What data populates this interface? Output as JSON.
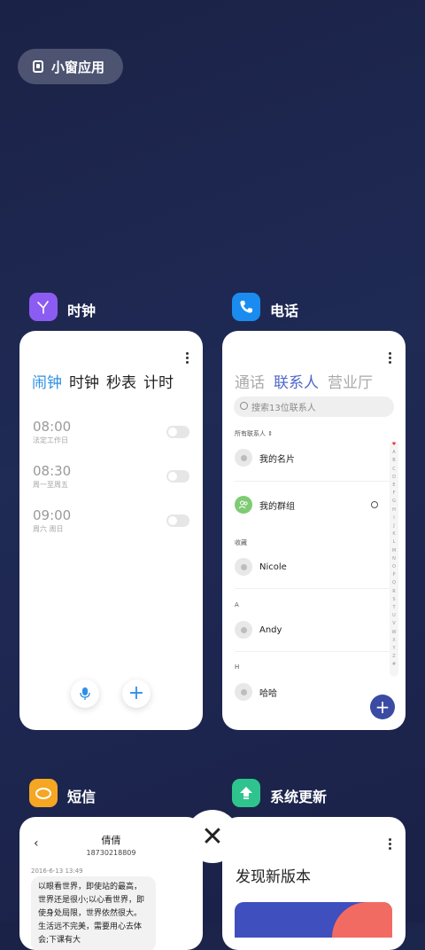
{
  "pill": {
    "label": "小窗应用",
    "icon": "small-window-icon"
  },
  "apps": {
    "clock": {
      "name": "时钟",
      "icon_color": "#8c5cf2",
      "tabs": [
        "闹钟",
        "时钟",
        "秒表",
        "计时"
      ],
      "alarms": [
        {
          "time": "08:00",
          "repeat": "法定工作日",
          "enabled": false
        },
        {
          "time": "08:30",
          "repeat": "周一至周五",
          "enabled": false
        },
        {
          "time": "09:00",
          "repeat": "周六 周日",
          "enabled": false
        }
      ]
    },
    "phone": {
      "name": "电话",
      "icon_color": "#1a8cf0",
      "tabs": [
        "通话",
        "联系人",
        "营业厅"
      ],
      "search_placeholder": "搜索13位联系人",
      "filter": "所有联系人",
      "my_card": "我的名片",
      "my_group": "我的群组",
      "sections": [
        {
          "header": "收藏",
          "contact": "Nicole"
        },
        {
          "header": "A",
          "contact": "Andy"
        },
        {
          "header": "H",
          "contact": "哈哈"
        }
      ],
      "index": [
        "♥",
        "A",
        "B",
        "C",
        "D",
        "E",
        "F",
        "G",
        "H",
        "I",
        "J",
        "K",
        "L",
        "M",
        "N",
        "O",
        "P",
        "Q",
        "R",
        "S",
        "T",
        "U",
        "V",
        "W",
        "X",
        "Y",
        "Z",
        "#"
      ]
    },
    "sms": {
      "name": "短信",
      "icon_color": "#f5a623",
      "contact_name": "倩倩",
      "contact_number": "18730218809",
      "timestamp": "2016-6-13 13:49",
      "message": "以眼看世界，即使站的最高，世界还是很小;以心看世界，即使身处局限，世界依然很大。生活远不完美，需要用心去体会;下课有大"
    },
    "update": {
      "name": "系统更新",
      "icon_color": "#2fc48d",
      "heading": "发现新版本"
    }
  },
  "close_label": "✕"
}
